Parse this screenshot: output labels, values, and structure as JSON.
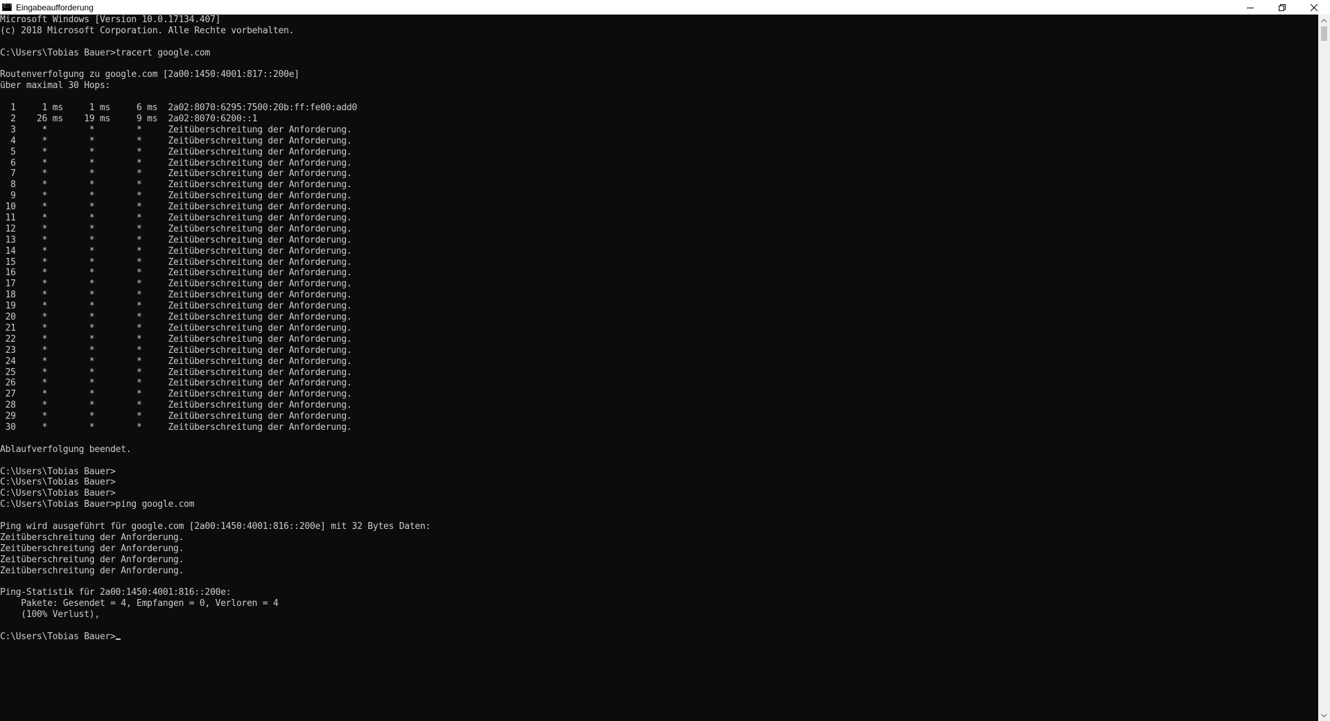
{
  "window": {
    "title": "Eingabeaufforderung",
    "icon": "cmd-icon",
    "icon_glyph": "C:\\",
    "controls": [
      "minimize-icon",
      "restore-icon",
      "close-icon"
    ]
  },
  "console": {
    "lines": [
      "Microsoft Windows [Version 10.0.17134.407]",
      "(c) 2018 Microsoft Corporation. Alle Rechte vorbehalten.",
      "",
      "C:\\Users\\Tobias Bauer>tracert google.com",
      "",
      "Routenverfolgung zu google.com [2a00:1450:4001:817::200e]",
      "über maximal 30 Hops:",
      "",
      "  1     1 ms     1 ms     6 ms  2a02:8070:6295:7500:20b:ff:fe00:add0",
      "  2    26 ms    19 ms     9 ms  2a02:8070:6200::1",
      "  3     *        *        *     Zeitüberschreitung der Anforderung.",
      "  4     *        *        *     Zeitüberschreitung der Anforderung.",
      "  5     *        *        *     Zeitüberschreitung der Anforderung.",
      "  6     *        *        *     Zeitüberschreitung der Anforderung.",
      "  7     *        *        *     Zeitüberschreitung der Anforderung.",
      "  8     *        *        *     Zeitüberschreitung der Anforderung.",
      "  9     *        *        *     Zeitüberschreitung der Anforderung.",
      " 10     *        *        *     Zeitüberschreitung der Anforderung.",
      " 11     *        *        *     Zeitüberschreitung der Anforderung.",
      " 12     *        *        *     Zeitüberschreitung der Anforderung.",
      " 13     *        *        *     Zeitüberschreitung der Anforderung.",
      " 14     *        *        *     Zeitüberschreitung der Anforderung.",
      " 15     *        *        *     Zeitüberschreitung der Anforderung.",
      " 16     *        *        *     Zeitüberschreitung der Anforderung.",
      " 17     *        *        *     Zeitüberschreitung der Anforderung.",
      " 18     *        *        *     Zeitüberschreitung der Anforderung.",
      " 19     *        *        *     Zeitüberschreitung der Anforderung.",
      " 20     *        *        *     Zeitüberschreitung der Anforderung.",
      " 21     *        *        *     Zeitüberschreitung der Anforderung.",
      " 22     *        *        *     Zeitüberschreitung der Anforderung.",
      " 23     *        *        *     Zeitüberschreitung der Anforderung.",
      " 24     *        *        *     Zeitüberschreitung der Anforderung.",
      " 25     *        *        *     Zeitüberschreitung der Anforderung.",
      " 26     *        *        *     Zeitüberschreitung der Anforderung.",
      " 27     *        *        *     Zeitüberschreitung der Anforderung.",
      " 28     *        *        *     Zeitüberschreitung der Anforderung.",
      " 29     *        *        *     Zeitüberschreitung der Anforderung.",
      " 30     *        *        *     Zeitüberschreitung der Anforderung.",
      "",
      "Ablaufverfolgung beendet.",
      "",
      "C:\\Users\\Tobias Bauer>",
      "C:\\Users\\Tobias Bauer>",
      "C:\\Users\\Tobias Bauer>",
      "C:\\Users\\Tobias Bauer>ping google.com",
      "",
      "Ping wird ausgeführt für google.com [2a00:1450:4001:816::200e] mit 32 Bytes Daten:",
      "Zeitüberschreitung der Anforderung.",
      "Zeitüberschreitung der Anforderung.",
      "Zeitüberschreitung der Anforderung.",
      "Zeitüberschreitung der Anforderung.",
      "",
      "Ping-Statistik für 2a00:1450:4001:816::200e:",
      "    Pakete: Gesendet = 4, Empfangen = 0, Verloren = 4",
      "    (100% Verlust),",
      ""
    ],
    "prompt": "C:\\Users\\Tobias Bauer>",
    "input_value": ""
  },
  "scrollbar": {
    "up_icon": "scroll-up-arrow-icon",
    "down_icon": "scroll-down-arrow-icon"
  },
  "colors": {
    "background": "#0c0c0c",
    "text": "#cccccc",
    "titlebar": "#ffffff"
  }
}
